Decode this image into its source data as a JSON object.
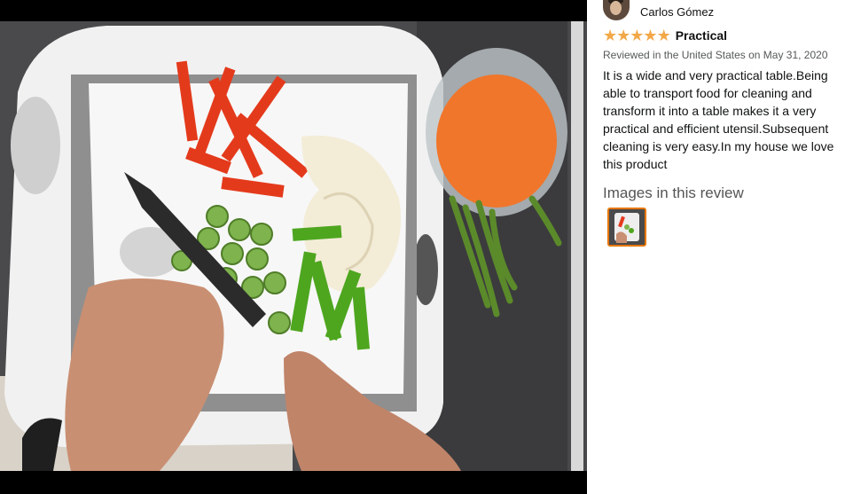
{
  "review": {
    "reviewer_name": "Carlos Gómez",
    "rating": 5,
    "stars": [
      "★",
      "★",
      "★",
      "★",
      "★"
    ],
    "title": "Practical",
    "date_line": "Reviewed in the United States on May 31, 2020",
    "body": "It is a wide and very practical table.Being able to transport food for cleaning and transform it into a table makes it a very practical and efficient utensil.Subsequent cleaning is very easy.In my house we love this product",
    "images_heading": "Images in this review",
    "image_count": 1
  },
  "colors": {
    "star": "#f3a847",
    "thumbnail_border": "#e77600",
    "viewer_background": "#000000"
  },
  "icons": {
    "rating": "star-icon",
    "avatar": "user-avatar"
  }
}
